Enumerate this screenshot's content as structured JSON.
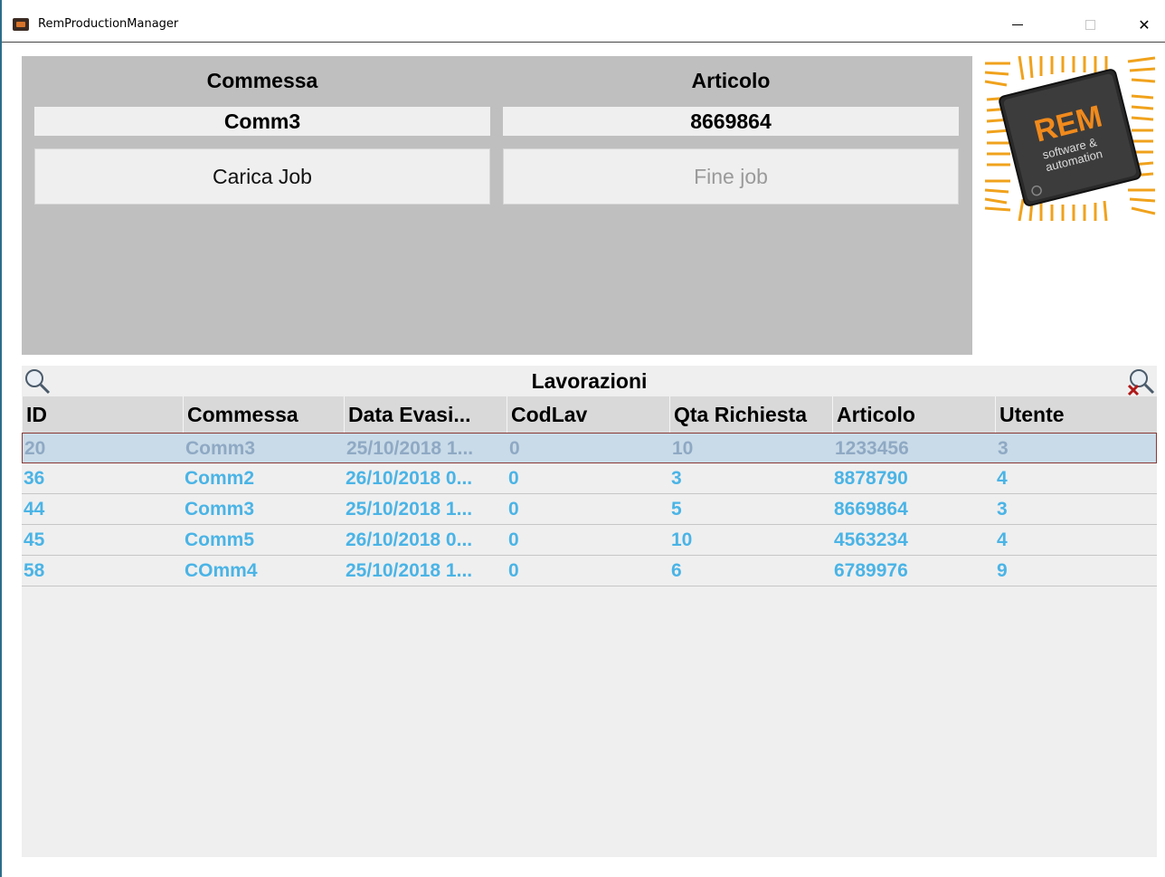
{
  "window": {
    "title": "RemProductionManager"
  },
  "top_panel": {
    "commessa_header": "Commessa",
    "articolo_header": "Articolo",
    "commessa_value": "Comm3",
    "articolo_value": "8669864",
    "load_job_label": "Carica Job",
    "end_job_label": "Fine job"
  },
  "logo": {
    "brand": "REM",
    "tagline_1": "software &",
    "tagline_2": "automation"
  },
  "grid": {
    "title": "Lavorazioni",
    "columns": [
      "ID",
      "Commessa",
      "Data Evasi...",
      "CodLav",
      "Qta Richiesta",
      "Articolo",
      "Utente"
    ],
    "rows": [
      [
        "20",
        "Comm3",
        "25/10/2018 1...",
        "0",
        "10",
        "1233456",
        "3"
      ],
      [
        "36",
        "Comm2",
        "26/10/2018 0...",
        "0",
        "3",
        "8878790",
        "4"
      ],
      [
        "44",
        "Comm3",
        "25/10/2018 1...",
        "0",
        "5",
        "8669864",
        "3"
      ],
      [
        "45",
        "Comm5",
        "26/10/2018 0...",
        "0",
        "10",
        "4563234",
        "4"
      ],
      [
        "58",
        "COmm4",
        "25/10/2018 1...",
        "0",
        "6",
        "6789976",
        "9"
      ]
    ],
    "selected_row": 0
  },
  "colors": {
    "row_text": "#4ab4e6",
    "selected_row_text": "#8fa9c4",
    "panel_bg": "#bfbfbf",
    "logo_orange": "#f08a1c"
  },
  "icons": {
    "search": "search-icon",
    "clear_filter": "clear-filter-icon",
    "minimize": "minimize-icon",
    "maximize": "maximize-icon",
    "close": "close-icon"
  }
}
